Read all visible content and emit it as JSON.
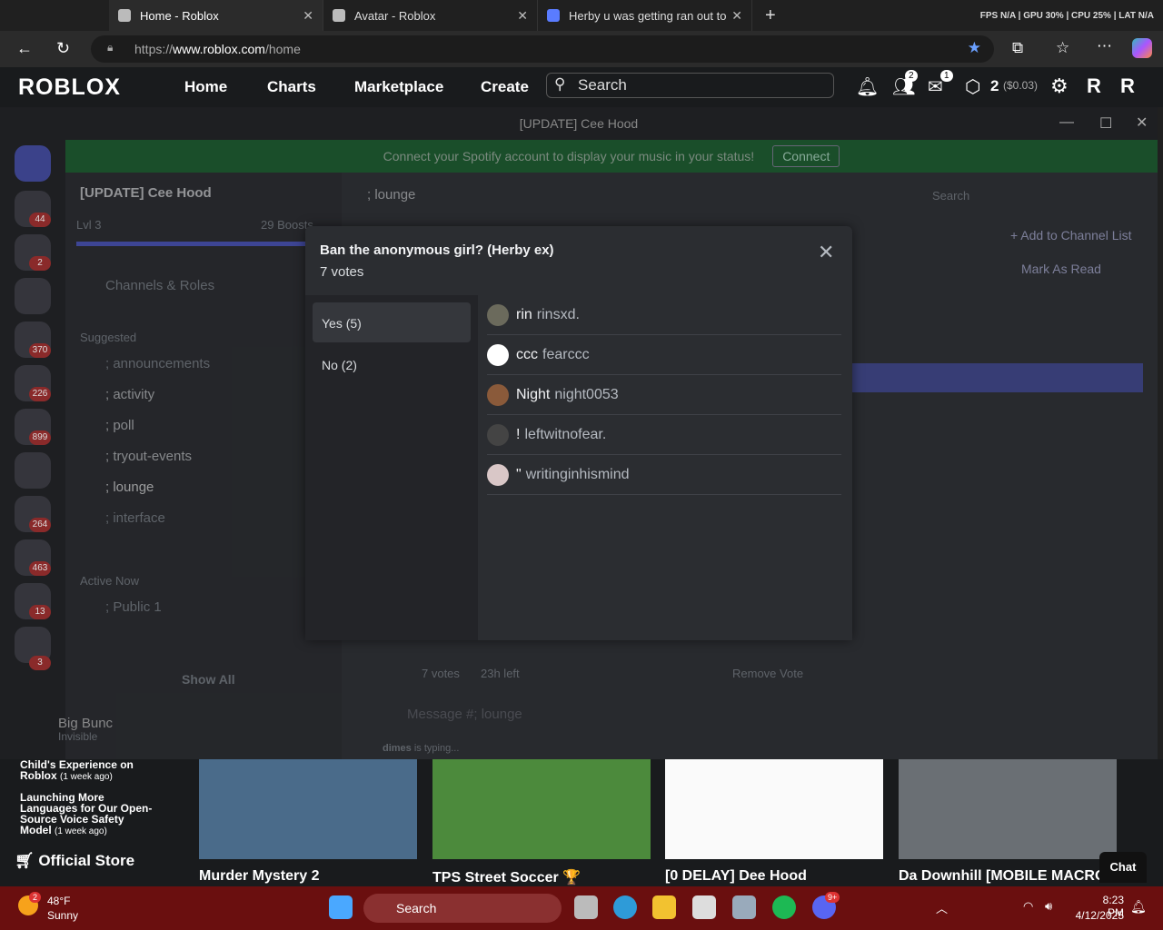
{
  "browser": {
    "tabs": [
      {
        "label": "Home - Roblox"
      },
      {
        "label": "Avatar - Roblox"
      },
      {
        "label": "Herby u was getting ran out to th"
      }
    ],
    "perf": "FPS N/A  |  GPU 30%  |  CPU 25%  |  LAT N/A",
    "url_prefix": "https://",
    "url_domain": "www.roblox.com",
    "url_path": "/home"
  },
  "roblox": {
    "logo": "ROBLOX",
    "nav": [
      "Home",
      "Charts",
      "Marketplace",
      "Create"
    ],
    "search_placeholder": "Search",
    "friends_badge": "2",
    "messages_badge": "1",
    "robux": "2",
    "robux_value": "($0.03)",
    "sidebar_news": [
      {
        "title": "Child's Experience on Roblox",
        "age": "(1 week ago)"
      },
      {
        "title": "Launching More Languages for Our Open-Source Voice Safety Model",
        "age": "(1 week ago)"
      }
    ],
    "official_store": "Official Store",
    "games": [
      "Murder Mystery 2",
      "TPS Street Soccer 🏆",
      "[0 DELAY] Dee Hood",
      "Da Downhill [MOBILE MACRO"
    ],
    "chat": "Chat"
  },
  "discord": {
    "window_title": "[UPDATE] Cee Hood",
    "spotify_text": "Connect your Spotify account to display your music in your status!",
    "spotify_connect": "Connect",
    "server_name": "[UPDATE] Cee Hood",
    "level": "Lvl 3",
    "boosts": "29 Boosts",
    "channels_roles": "Channels & Roles",
    "suggested": "Suggested",
    "channels": [
      "; announcements",
      "; activity",
      "; poll",
      "; tryout-events",
      "; lounge",
      "; interface"
    ],
    "active_now": "Active Now",
    "voice_channel": "; Public 1",
    "show_all": "Show All",
    "user_name": "Big Bunc",
    "user_status": "Invisible",
    "channel_header": "; lounge",
    "header_search": "Search",
    "add_channel": "+ Add to Channel List",
    "mark_read": "Mark As Read",
    "poll_footer_votes": "7 votes",
    "poll_footer_time": "23h left",
    "remove_vote": "Remove Vote",
    "message_placeholder": "Message #; lounge",
    "typing_user": "dimes",
    "typing_text": "is typing...",
    "guild_badges": [
      "44",
      "2",
      "",
      "370",
      "226",
      "899",
      "",
      "264",
      "463",
      "13",
      "3"
    ]
  },
  "modal": {
    "title": "Ban the anonymous girl? (Herby ex)",
    "votes": "7 votes",
    "options": [
      {
        "label": "Yes",
        "count": "(5)"
      },
      {
        "label": "No",
        "count": "(2)"
      }
    ],
    "voters": [
      {
        "display": "rin",
        "username": "rinsxd."
      },
      {
        "display": "ccc",
        "username": "fearccc"
      },
      {
        "display": "Night",
        "username": "night0053"
      },
      {
        "display": "!",
        "username": "leftwitnofear."
      },
      {
        "display": "\"",
        "username": "writinginhismind"
      }
    ]
  },
  "taskbar": {
    "temp": "48°F",
    "weather": "Sunny",
    "weather_badge": "2",
    "search": "Search",
    "time": "8:23 PM",
    "date": "4/12/2025",
    "discord_badge": "9+"
  }
}
